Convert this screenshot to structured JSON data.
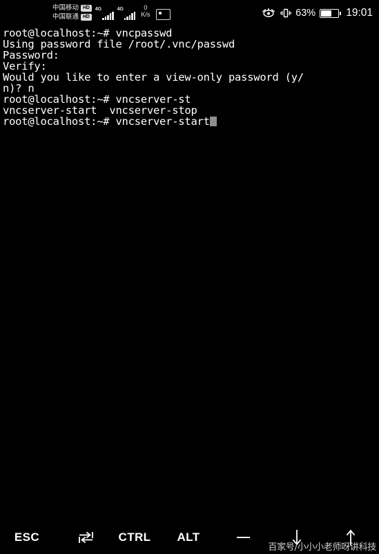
{
  "statusbar": {
    "carrier_primary": "中国移动",
    "carrier_secondary": "中国联通",
    "hd_badge": "HD",
    "network_type_1": "4G",
    "network_type_2": "4G",
    "netspeed_value": "0",
    "netspeed_unit": "K/s",
    "cast_icon_name": "screen-cast-icon",
    "eye_icon_name": "eye-comfort-icon",
    "vibrate_icon_name": "vibrate-icon",
    "battery_percent": "63%",
    "battery_level": 63,
    "clock": "19:01",
    "colors": {
      "background": "#000000",
      "text": "#ffffff",
      "muted": "#e8e8e8"
    }
  },
  "terminal": {
    "colors": {
      "background": "#000000",
      "foreground": "#ffffff",
      "cursor": "#8f8f8f"
    },
    "lines": [
      "root@localhost:~# vncpasswd",
      "Using password file /root/.vnc/passwd",
      "Password:",
      "Verify:",
      "Would you like to enter a view-only password (y/",
      "n)? n",
      "root@localhost:~# vncserver-st",
      "vncserver-start  vncserver-stop"
    ],
    "prompt_line": "root@localhost:~# vncserver-start",
    "cursor_name": "terminal-cursor"
  },
  "keybar": {
    "keys": [
      {
        "label": "ESC",
        "name": "key-esc"
      },
      {
        "label": "",
        "name": "key-tab",
        "icon": "tab-icon"
      },
      {
        "label": "CTRL",
        "name": "key-ctrl"
      },
      {
        "label": "ALT",
        "name": "key-alt"
      },
      {
        "label": "",
        "name": "key-minus",
        "icon": "minus-icon"
      },
      {
        "label": "",
        "name": "key-down",
        "icon": "arrow-down-icon"
      },
      {
        "label": "",
        "name": "key-up",
        "icon": "arrow-up-icon"
      }
    ],
    "esc_label": "ESC",
    "ctrl_label": "CTRL",
    "alt_label": "ALT"
  },
  "watermark": {
    "text": "百家号/小小小老师呀讲科技"
  }
}
